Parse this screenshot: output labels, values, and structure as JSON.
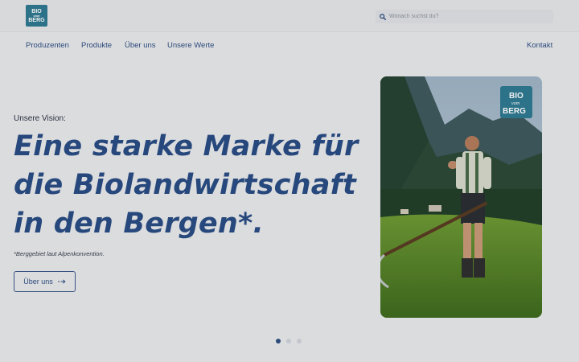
{
  "header": {
    "logo": {
      "line1": "BIO",
      "line2": "vom",
      "line3": "BERG"
    },
    "search": {
      "placeholder": "Wonach suchst du?"
    }
  },
  "nav": {
    "items": [
      "Produzenten",
      "Produkte",
      "Über uns",
      "Unsere Werte"
    ],
    "contact": "Kontakt"
  },
  "hero": {
    "kicker": "Unsere Vision:",
    "title": "Eine starke Marke für die Biolandwirtschaft in den Bergen*.",
    "note": "*Berggebiet laut Alpenkonvention.",
    "button": "Über uns",
    "button_icon": "arrow-right-icon",
    "image_badge": {
      "line1": "BIO",
      "line2": "vom",
      "line3": "BERG"
    }
  },
  "carousel": {
    "total": 3,
    "active": 1
  },
  "colors": {
    "accent": "#2f4f83",
    "title": "#2a4d84",
    "logo": "#2f7a91",
    "background": "#e9eaec"
  }
}
